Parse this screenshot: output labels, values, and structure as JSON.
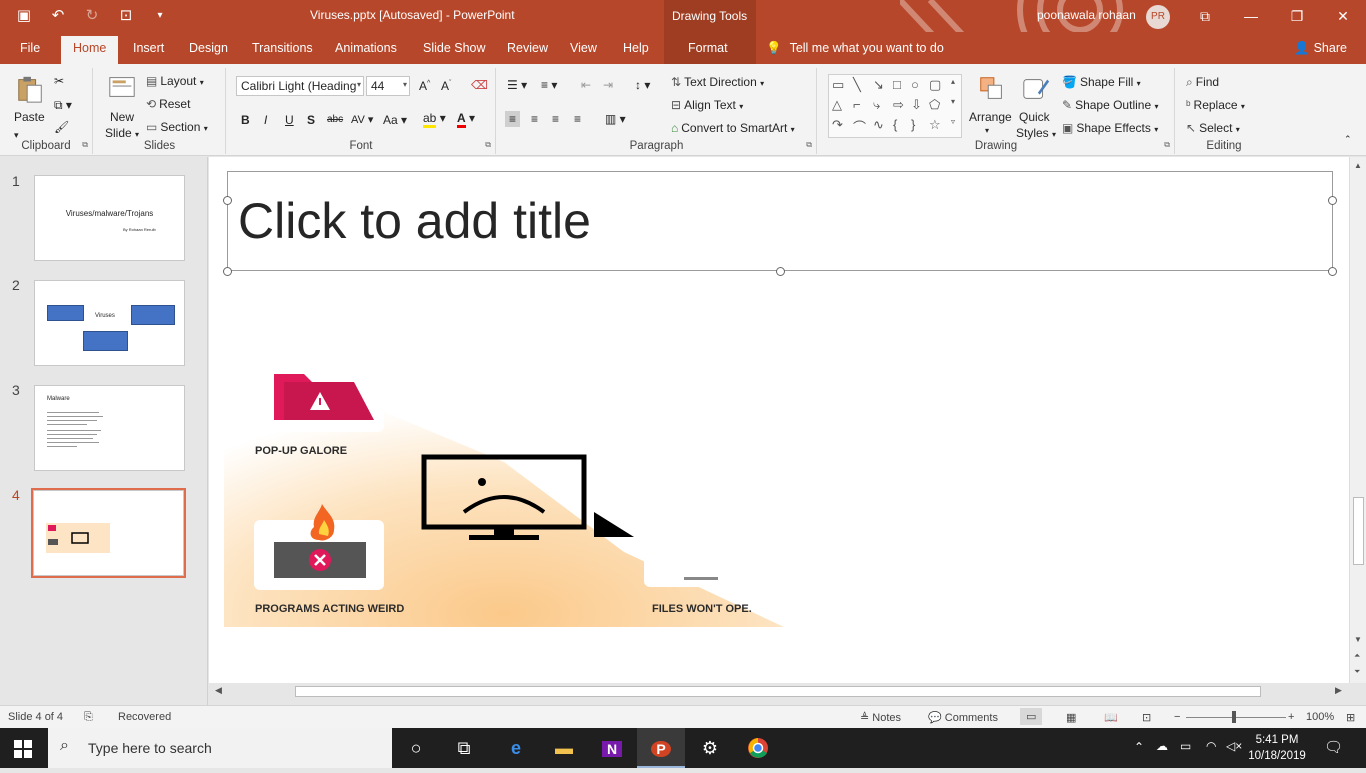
{
  "window": {
    "doc_title": "Viruses.pptx [Autosaved]  -  PowerPoint",
    "context_tab": "Drawing Tools",
    "user_name": "poonawala rohaan",
    "user_initials": "PR"
  },
  "tabs": [
    "File",
    "Home",
    "Insert",
    "Design",
    "Transitions",
    "Animations",
    "Slide Show",
    "Review",
    "View",
    "Help",
    "Format"
  ],
  "tell_me": "Tell me what you want to do",
  "share_label": "Share",
  "ribbon": {
    "clipboard": {
      "label": "Clipboard",
      "paste": "Paste"
    },
    "slides": {
      "label": "Slides",
      "new_slide": "New",
      "new_slide2": "Slide",
      "layout": "Layout",
      "reset": "Reset",
      "section": "Section"
    },
    "font": {
      "label": "Font",
      "font_name": "Calibri Light (Heading",
      "font_size": "44"
    },
    "paragraph": {
      "label": "Paragraph",
      "text_direction": "Text Direction",
      "align_text": "Align Text",
      "smartart": "Convert to SmartArt"
    },
    "drawing": {
      "label": "Drawing",
      "arrange": "Arrange",
      "quick": "Quick",
      "styles": "Styles",
      "shape_fill": "Shape Fill",
      "shape_outline": "Shape Outline",
      "shape_effects": "Shape Effects"
    },
    "editing": {
      "label": "Editing",
      "find": "Find",
      "replace": "Replace",
      "select": "Select"
    }
  },
  "thumbnails": [
    {
      "num": "1",
      "title": "Viruses/malware/Trojans",
      "subtitle": "By Rohaan Rerulb"
    },
    {
      "num": "2",
      "center": "Viruses"
    },
    {
      "num": "3",
      "title": "Malware"
    },
    {
      "num": "4"
    }
  ],
  "slide": {
    "title_placeholder": "Click to add title",
    "labels": {
      "popup": "POP-UP GALORE",
      "programs": "PROGRAMS ACTING WEIRD",
      "files": "FILES WON'T OPE."
    }
  },
  "status": {
    "slide_info": "Slide 4 of 4",
    "recovered": "Recovered",
    "notes": "Notes",
    "comments": "Comments",
    "zoom": "100%"
  },
  "taskbar": {
    "search_placeholder": "Type here to search",
    "time": "5:41 PM",
    "date": "10/18/2019"
  },
  "colors": {
    "accent": "#b7472a",
    "popup_pink": "#e0195b",
    "fire": "#f26522"
  }
}
